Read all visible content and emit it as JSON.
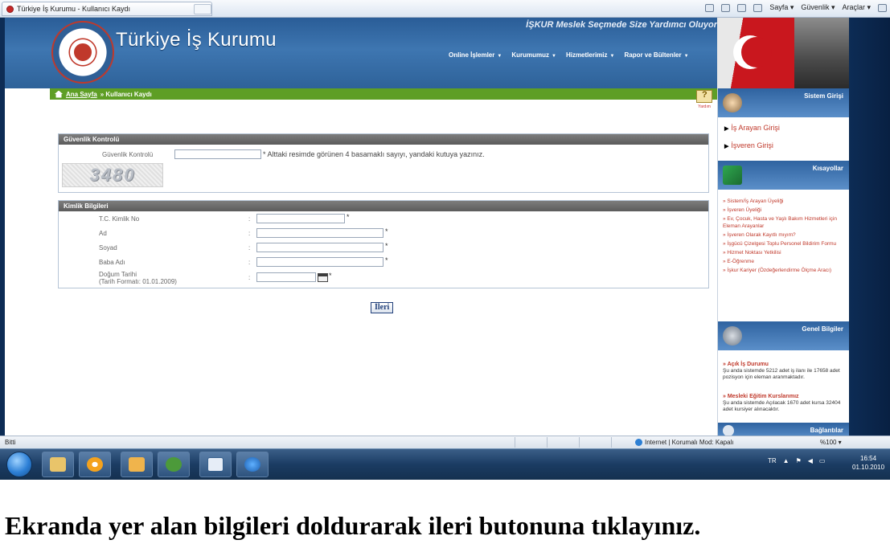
{
  "browser": {
    "tab_title": "Türkiye İş Kurumu - Kullanıcı Kaydı",
    "commands": [
      "Sayfa ▾",
      "Güvenlik ▾",
      "Araçlar ▾"
    ],
    "status_left": "Bitti",
    "status_zone": "Internet | Korumalı Mod: Kapalı",
    "zoom": "%100 ▾"
  },
  "header": {
    "site_title": "Türkiye İş Kurumu",
    "slogan": "İŞKUR Meslek Seçmede Size Yardımcı Oluyor",
    "nav": [
      "Online İşlemler",
      "Kurumumuz",
      "Hizmetlerimiz",
      "Rapor ve Bültenler"
    ]
  },
  "breadcrumb": {
    "home": "Ana Sayfa",
    "current": "» Kullanıcı Kaydı",
    "help": "Yardım"
  },
  "security": {
    "title": "Güvenlik Kontrolü",
    "label": "Güvenlik Kontrolü",
    "note": "* Alttaki resimde görünen 4 basamaklı sayıyı, yandaki kutuya yazınız.",
    "captcha": "3480"
  },
  "identity": {
    "title": "Kimlik Bilgileri",
    "fields": [
      {
        "label": "T.C. Kimlik No",
        "value": ""
      },
      {
        "label": "Ad",
        "value": ""
      },
      {
        "label": "Soyad",
        "value": ""
      },
      {
        "label": "Baba Adı",
        "value": ""
      },
      {
        "label": "Doğum Tarihi",
        "hint": "(Tarih Formatı: 01.01.2009)",
        "value": ""
      }
    ],
    "colon": ":",
    "required": "*"
  },
  "next_button": "İleri",
  "sidebar": {
    "login_title": "Sistem Girişi",
    "login_links": [
      "İş Arayan Girişi",
      "İşveren Girişi"
    ],
    "shortcuts_title": "Kısayollar",
    "shortcuts": [
      "» Sistem/İş Arayan Üyeliği",
      "» İşveren Üyeliği",
      "» Ev, Çocuk, Hasta ve Yaşlı Bakım Hizmetleri için Eleman Arayanlar",
      "» İşveren Olarak Kayıtlı mıyım?",
      "» İşgücü Çizelgesi Toplu Personel Bildirim Formu",
      "» Hizmet Noktası Yetkilisi",
      "» E-Öğrenme",
      "» İşkur Kariyer (Özdeğerlendirme Ölçme Aracı)"
    ],
    "general_title": "Genel Bilgiler",
    "open_jobs_title": "» Açık İş Durumu",
    "open_jobs_text": "Şu anda sistemde 5212 adet iş ilanı ile 17658 adet pozisyon için eleman aranmaktadır.",
    "courses_title": "» Mesleki Eğitim Kurslarımız",
    "courses_text": "Şu anda sistemde Açılacak 1670 adet kursa 32404 adet kursiyer alınacaktır.",
    "links_title": "Bağlantılar"
  },
  "taskbar": {
    "lang": "TR",
    "time": "16:54",
    "date": "01.10.2010"
  },
  "instruction": "Ekranda yer alan bilgileri doldurarak ileri butonuna tıklayınız."
}
